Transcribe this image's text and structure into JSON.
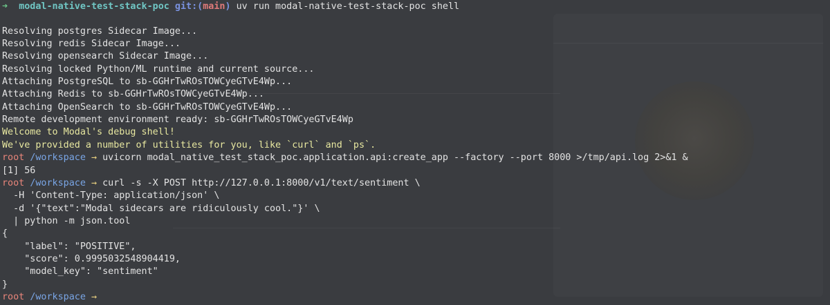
{
  "prompt": {
    "arrow": "➜",
    "directory": "modal-native-test-stack-poc",
    "git_label": "git:(",
    "branch": "main",
    "git_close": ")",
    "command": "uv run modal-native-test-stack-poc shell"
  },
  "output_lines": [
    "Resolving postgres Sidecar Image...",
    "Resolving redis Sidecar Image...",
    "Resolving opensearch Sidecar Image...",
    "Resolving locked Python/ML runtime and current source...",
    "Attaching PostgreSQL to sb-GGHrTwROsTOWCyeGTvE4Wp...",
    "Attaching Redis to sb-GGHrTwROsTOWCyeGTvE4Wp...",
    "Attaching OpenSearch to sb-GGHrTwROsTOWCyeGTvE4Wp...",
    "Remote development environment ready: sb-GGHrTwROsTOWCyeGTvE4Wp"
  ],
  "welcome_lines": [
    "Welcome to Modal's debug shell!",
    "We've provided a number of utilities for you, like `curl` and `ps`."
  ],
  "shell_prompt": {
    "user": "root",
    "path": "/workspace",
    "arrow": "→"
  },
  "command_1": "uvicorn modal_native_test_stack_poc.application.api:create_app --factory --port 8000 >/tmp/api.log 2>&1 &",
  "job_line": "[1] 56",
  "command_2": [
    "curl -s -X POST http://127.0.0.1:8000/v1/text/sentiment \\",
    "  -H 'Content-Type: application/json' \\",
    "  -d '{\"text\":\"Modal sidecars are ridiculously cool.\"}' \\",
    "  | python -m json.tool"
  ],
  "json_output": [
    "{",
    "    \"label\": \"POSITIVE\",",
    "    \"score\": 0.9995032548904419,",
    "    \"model_key\": \"sentiment\"",
    "}"
  ],
  "colors": {
    "background": "#3a3c40",
    "prompt_arrow": "#6cc88a",
    "directory": "#70c6c4",
    "git": "#7a92e0",
    "branch": "#e07a7a",
    "welcome": "#e8e8a0",
    "root": "#e8857a",
    "path": "#7aa6e6"
  }
}
